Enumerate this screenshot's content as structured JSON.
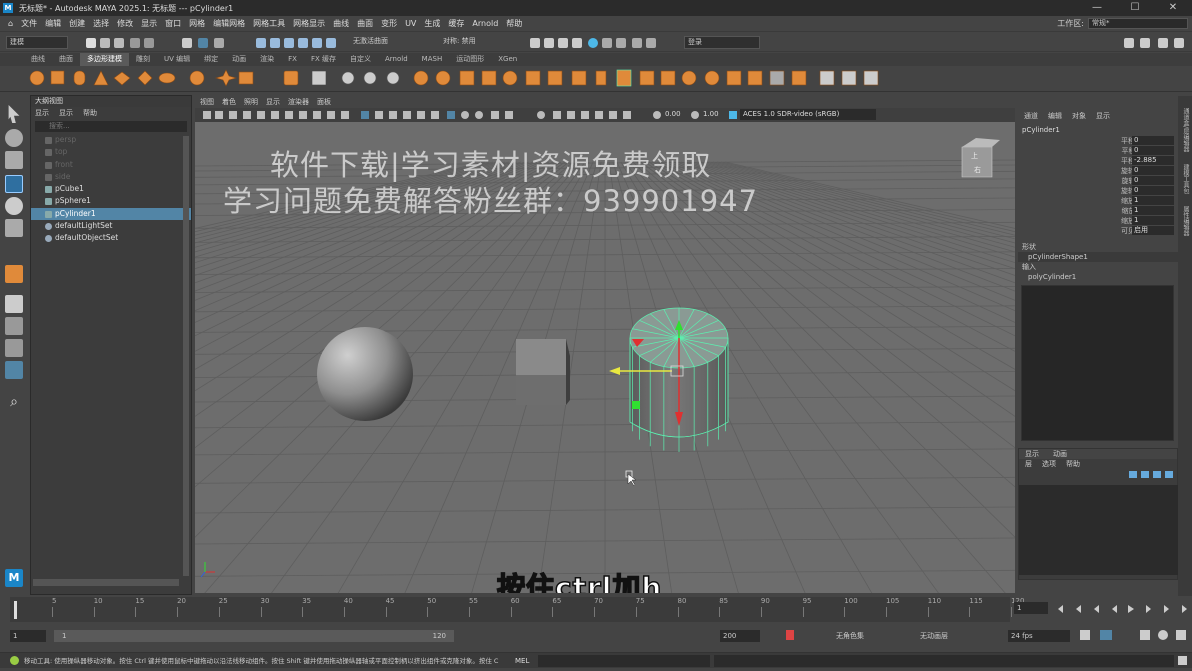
{
  "window": {
    "title": "无标题* - Autodesk MAYA 2025.1: 无标题   ---   pCylinder1",
    "controls": [
      "—",
      "☐",
      "✕"
    ]
  },
  "menubar": {
    "items": [
      "文件",
      "编辑",
      "创建",
      "选择",
      "修改",
      "显示",
      "窗口",
      "网格",
      "编辑网格",
      "网格工具",
      "网格显示",
      "曲线",
      "曲面",
      "变形",
      "UV",
      "生成",
      "缓存",
      "Arnold",
      "帮助"
    ],
    "workspace_label": "工作区:",
    "workspace_value": "常规*"
  },
  "statusline": {
    "mode_menu": "建模",
    "selection_mode": "无激活曲面",
    "symmetry": "对称: 禁用",
    "login": "登录"
  },
  "shelf": {
    "tabs": [
      "曲线",
      "曲面",
      "多边形建模",
      "雕刻",
      "UV 编辑",
      "绑定",
      "动画",
      "渲染",
      "FX",
      "FX 缓存",
      "自定义",
      "Arnold",
      "MASH",
      "运动图形",
      "XGen"
    ],
    "active_tab": "多边形建模"
  },
  "outliner": {
    "title": "大纲视图",
    "menu": [
      "显示",
      "显示",
      "帮助"
    ],
    "search_placeholder": "搜索...",
    "items": [
      {
        "label": "persp",
        "dim": true
      },
      {
        "label": "top",
        "dim": true
      },
      {
        "label": "front",
        "dim": true
      },
      {
        "label": "side",
        "dim": true
      },
      {
        "label": "pCube1",
        "dim": false
      },
      {
        "label": "pSphere1",
        "dim": false
      },
      {
        "label": "pCylinder1",
        "dim": false,
        "selected": true
      },
      {
        "label": "defaultLightSet",
        "dim": false
      },
      {
        "label": "defaultObjectSet",
        "dim": false
      }
    ]
  },
  "viewport": {
    "menu": [
      "视图",
      "着色",
      "照明",
      "显示",
      "渲染器",
      "面板"
    ],
    "exposure": "0.00",
    "gamma": "1.00",
    "colorspace": "ACES 1.0 SDR-video (sRGB)",
    "watermark_line1": "软件下载|学习素材|资源免费领取",
    "watermark_line2": "学习问题免费解答粉丝群：939901947",
    "subtitle": "按住ctrl加h",
    "viewcube_top": "上",
    "viewcube_front": "右"
  },
  "attribute_editor": {
    "tabs": [
      "通道",
      "编辑",
      "对象",
      "显示"
    ],
    "node": "pCylinder1",
    "rows": [
      {
        "label": "平移 X",
        "value": "0"
      },
      {
        "label": "平移 Y",
        "value": "0"
      },
      {
        "label": "平移 Z",
        "value": "-2.885"
      },
      {
        "label": "旋转 X",
        "value": "0"
      },
      {
        "label": "旋转 Y",
        "value": "0"
      },
      {
        "label": "旋转 Z",
        "value": "0"
      },
      {
        "label": "缩放 X",
        "value": "1"
      },
      {
        "label": "缩放 Y",
        "value": "1"
      },
      {
        "label": "缩放 Z",
        "value": "1"
      },
      {
        "label": "可见性",
        "value": "启用"
      }
    ],
    "shape_header": "形状",
    "shape": "pCylinderShape1",
    "input_header": "输入",
    "input": "polyCylinder1",
    "layer_tabs": [
      "显示",
      "动画"
    ],
    "layer_menu": [
      "层",
      "选项",
      "帮助"
    ]
  },
  "side_tabs": [
    "通道盒/层编辑器",
    "建模工具包",
    "属性编辑器"
  ],
  "timeline": {
    "ticks": [
      "5",
      "10",
      "15",
      "20",
      "25",
      "30",
      "35",
      "40",
      "45",
      "50",
      "55",
      "60",
      "65",
      "70",
      "75",
      "80",
      "85",
      "90",
      "95",
      "100",
      "105",
      "110",
      "115",
      "120"
    ],
    "current_frame": "1"
  },
  "range": {
    "start": "1",
    "inner_start": "1",
    "inner_end": "120",
    "end": "200",
    "char_set": "无角色集",
    "anim_layer": "无动画层",
    "fps": "24 fps"
  },
  "cmdline": {
    "help": "移动工具: 使用操纵器移动对象。按住 Ctrl 键并使用鼠标中键拖动以沿法线移动组件。按住 Shift 键并使用拖动操纵器轴或平面控制柄以挤出组件或克隆对象。按住 C",
    "lang": "MEL"
  },
  "colors": {
    "selection": "#5285a6",
    "cylinder_wire": "#5cf0b0",
    "shelf_icon": "#e08a3a"
  }
}
